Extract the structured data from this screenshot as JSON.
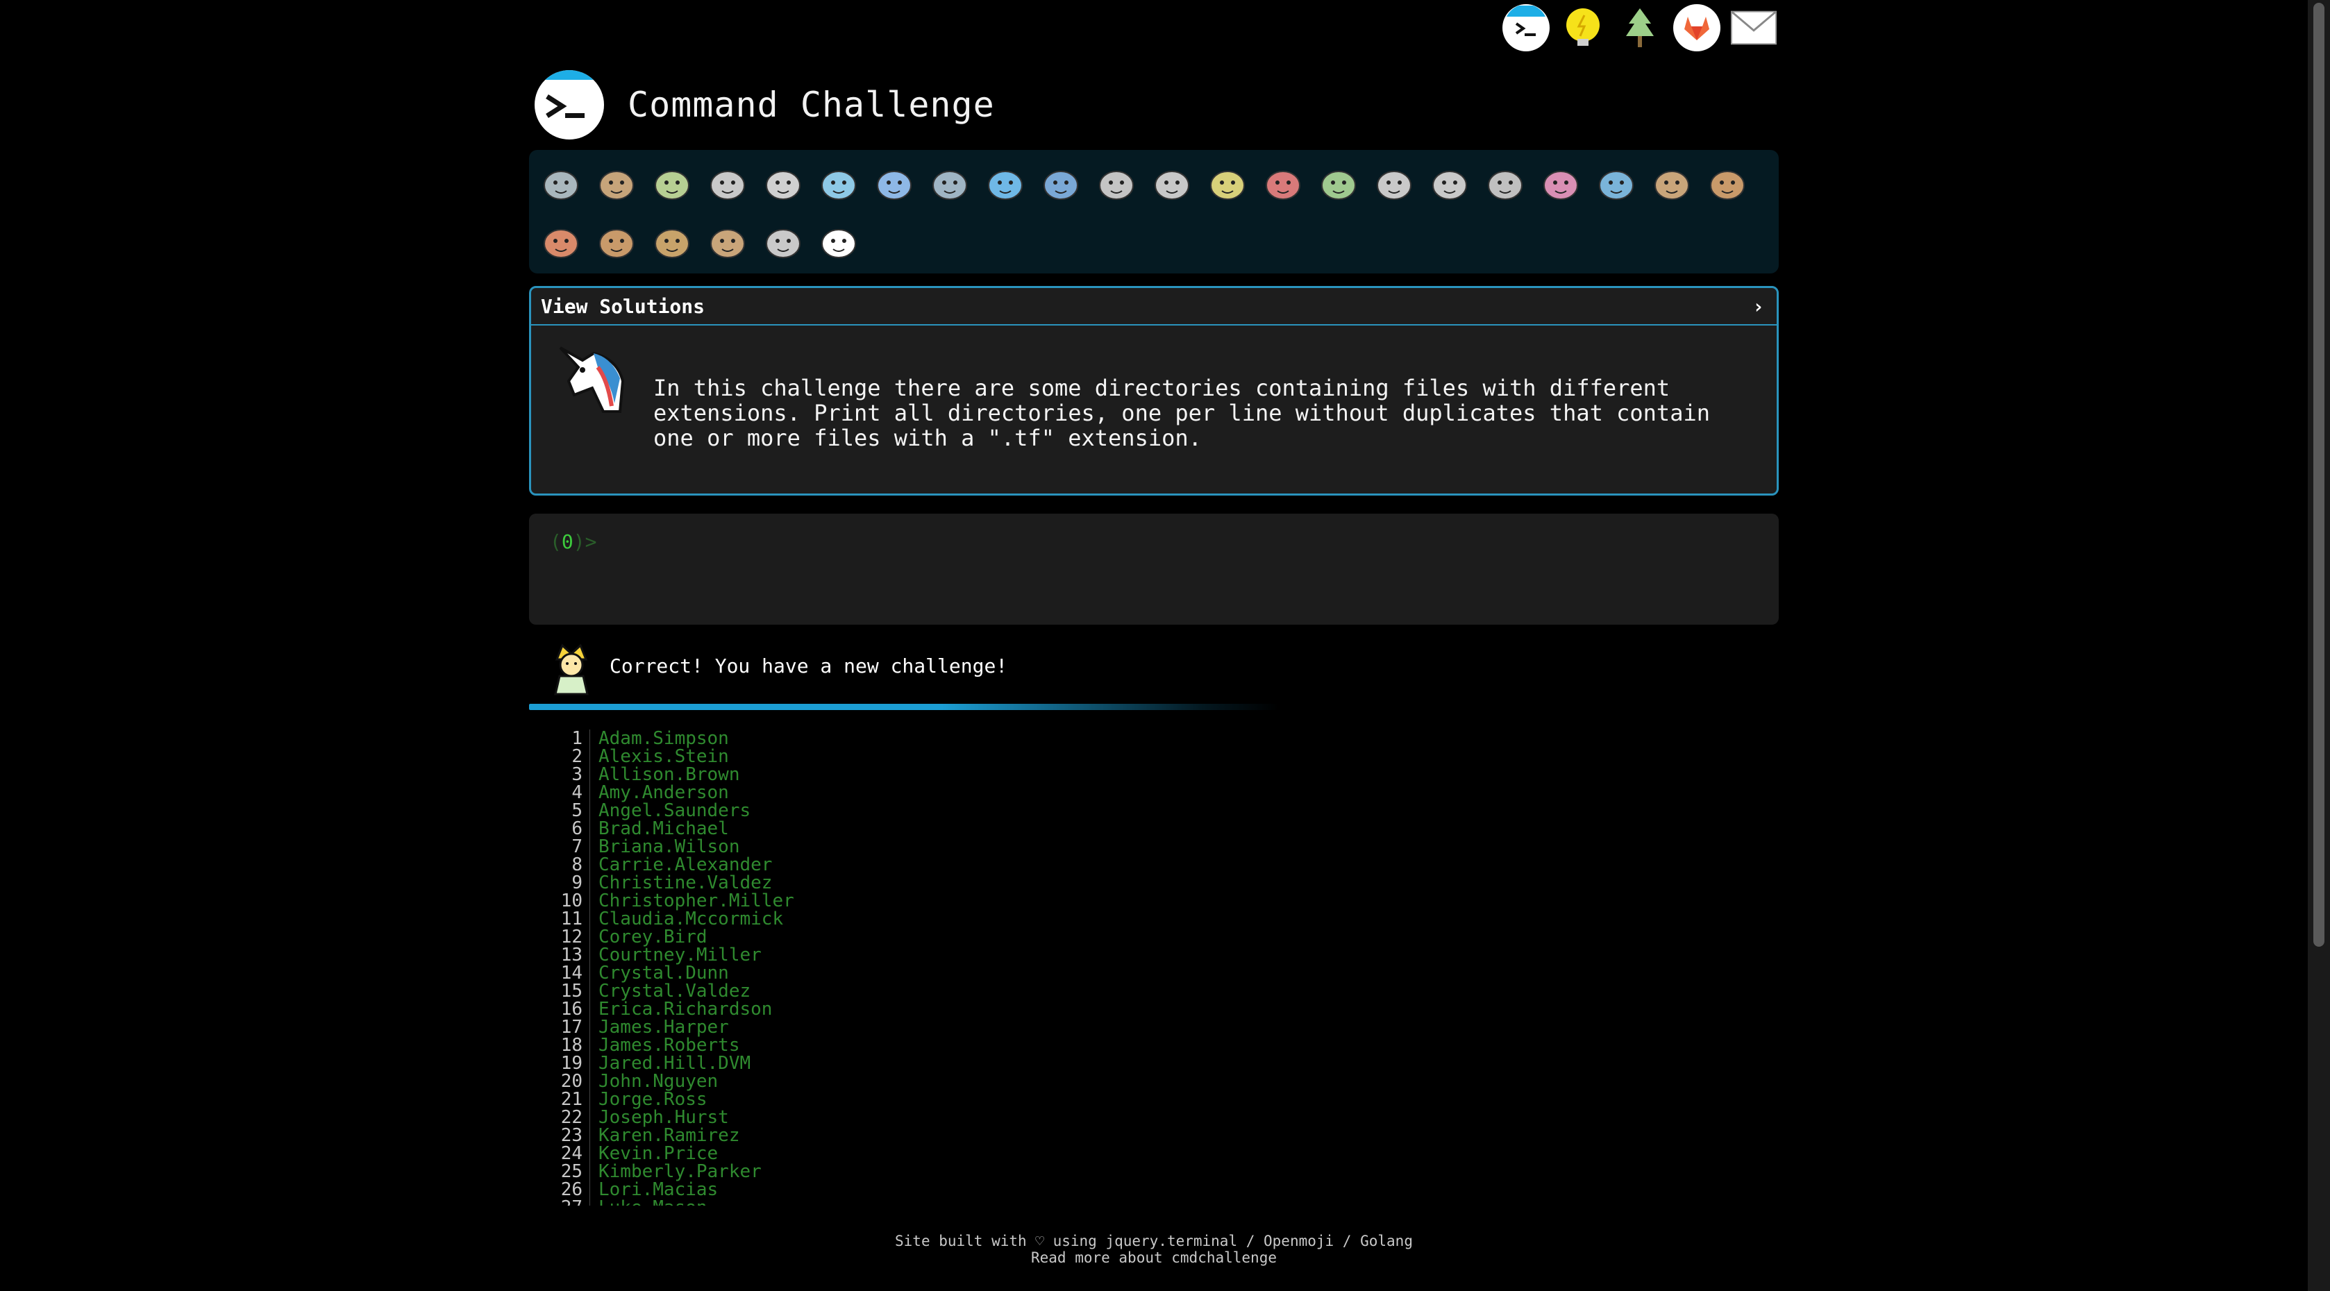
{
  "top_icons": [
    {
      "name": "terminal-icon"
    },
    {
      "name": "lightbulb-icon"
    },
    {
      "name": "tree-icon"
    },
    {
      "name": "gitlab-icon"
    },
    {
      "name": "mail-icon"
    }
  ],
  "header": {
    "title": "Command Challenge"
  },
  "levels": [
    "snail-icon",
    "butterfly-icon",
    "caterpillar-icon",
    "ant-icon",
    "microbe-icon",
    "whale-icon",
    "dolphin-icon",
    "shark-icon",
    "fish-icon",
    "tropical-fish-icon",
    "blowfish-icon",
    "wolf-icon",
    "bee-icon",
    "ladybug-icon",
    "cricket-icon",
    "spider-icon",
    "scorpion-icon",
    "fly-icon",
    "worm-icon",
    "microbe2-icon",
    "monkey-icon",
    "dog-icon",
    "fox-icon",
    "cat-icon",
    "lion-icon",
    "tiger-icon",
    "horse-icon",
    "unicorn-icon"
  ],
  "panel": {
    "title": "View Solutions",
    "chevron": "›",
    "challenge": "In this challenge there are some directories containing files with different extensions. Print all directories, one per line without duplicates that contain one or more files with a \".tf\" extension."
  },
  "terminal": {
    "prompt_open": "(",
    "prompt_num": "0",
    "prompt_close": ")>"
  },
  "status": {
    "message": "Correct! You have a new challenge!"
  },
  "output": [
    "Adam.Simpson",
    "Alexis.Stein",
    "Allison.Brown",
    "Amy.Anderson",
    "Angel.Saunders",
    "Brad.Michael",
    "Briana.Wilson",
    "Carrie.Alexander",
    "Christine.Valdez",
    "Christopher.Miller",
    "Claudia.Mccormick",
    "Corey.Bird",
    "Courtney.Miller",
    "Crystal.Dunn",
    "Crystal.Valdez",
    "Erica.Richardson",
    "James.Harper",
    "James.Roberts",
    "Jared.Hill.DVM",
    "John.Nguyen",
    "Jorge.Ross",
    "Joseph.Hurst",
    "Karen.Ramirez",
    "Kevin.Price",
    "Kimberly.Parker",
    "Lori.Macias",
    "Luke.Mason"
  ],
  "footer": {
    "line1": "Site built with ♡ using jquery.terminal / Openmoji / Golang",
    "line2": "Read more about cmdchallenge"
  },
  "colors": {
    "accent": "#2a93bd",
    "progress": "#1c9ed4",
    "output_text": "#2f8a2f"
  }
}
